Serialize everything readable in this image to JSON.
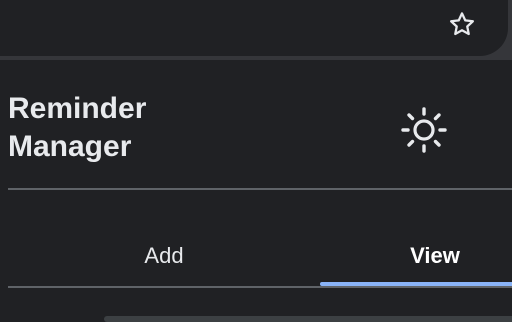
{
  "app": {
    "title": "Reminder Manager"
  },
  "icons": {
    "bookmark": "star-outline",
    "theme_toggle": "sun"
  },
  "tabs": [
    {
      "label": "Add",
      "selected": false
    },
    {
      "label": "View",
      "selected": true
    }
  ],
  "colors": {
    "accent": "#8ab4f8",
    "background": "#202124",
    "text": "#e8eaed",
    "divider": "#5f6368"
  }
}
